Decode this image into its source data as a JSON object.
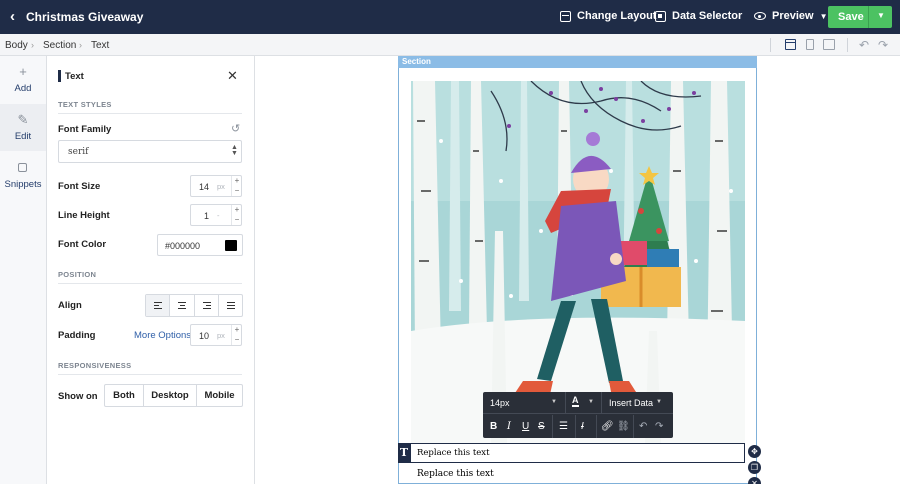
{
  "topbar": {
    "title": "Christmas Giveaway",
    "change_layout": "Change Layout",
    "data_selector": "Data Selector",
    "preview": "Preview",
    "save": "Save"
  },
  "breadcrumb": [
    "Body",
    "Section",
    "Text"
  ],
  "rail": [
    {
      "label": "Add",
      "icon": "plus-icon"
    },
    {
      "label": "Edit",
      "icon": "pencil-icon"
    },
    {
      "label": "Snippets",
      "icon": "snippet-icon"
    }
  ],
  "panel": {
    "title": "Text",
    "text_styles": "TEXT STYLES",
    "font_family_label": "Font Family",
    "font_family_value": "serif",
    "font_size_label": "Font Size",
    "font_size_value": "14",
    "font_size_unit": "px",
    "line_height_label": "Line Height",
    "line_height_value": "1",
    "line_height_unit": "-",
    "font_color_label": "Font Color",
    "font_color_value": "#000000",
    "position": "POSITION",
    "align_label": "Align",
    "padding_label": "Padding",
    "more_options": "More Options",
    "padding_value": "10",
    "padding_unit": "px",
    "responsiveness": "RESPONSIVENESS",
    "show_on_label": "Show on",
    "show_on_options": [
      "Both",
      "Desktop",
      "Mobile"
    ]
  },
  "canvas": {
    "section_label": "Section",
    "edit_text": "Replace this text",
    "copy_text": "Replace this text",
    "text_marker": "T"
  },
  "rte": {
    "font_size": "14px",
    "font_color_glyph": "A",
    "insert_data": "Insert Data",
    "bold": "B",
    "italic": "I",
    "underline": "U",
    "strike": "S",
    "clear_format": "I"
  },
  "colors": {
    "topbar": "#1f2c47",
    "save": "#4cc262",
    "section_outline": "#7fb0d9",
    "link": "#2f5fa8"
  }
}
